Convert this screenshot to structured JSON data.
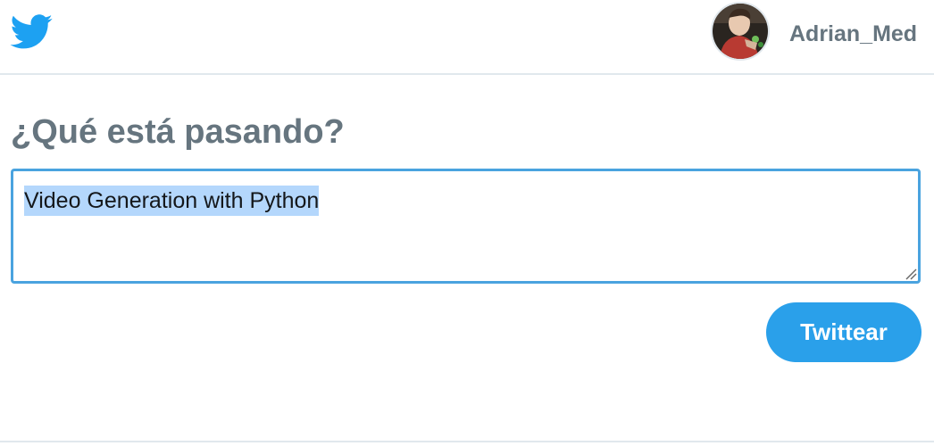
{
  "header": {
    "logo_icon": "twitter-bird-icon",
    "avatar_icon": "user-avatar-icon",
    "username": "Adrian_Med"
  },
  "composer": {
    "prompt": "¿Qué está pasando?",
    "text": "Video Generation with Python",
    "text_selected": true
  },
  "actions": {
    "tweet_label": "Twittear"
  },
  "colors": {
    "brand_blue": "#1da1f2",
    "button_blue": "#2aa0ea",
    "focus_border": "#4aa3df",
    "selection": "#b4d7fc",
    "muted_text": "#66757f",
    "divider": "#e1e8ed"
  }
}
